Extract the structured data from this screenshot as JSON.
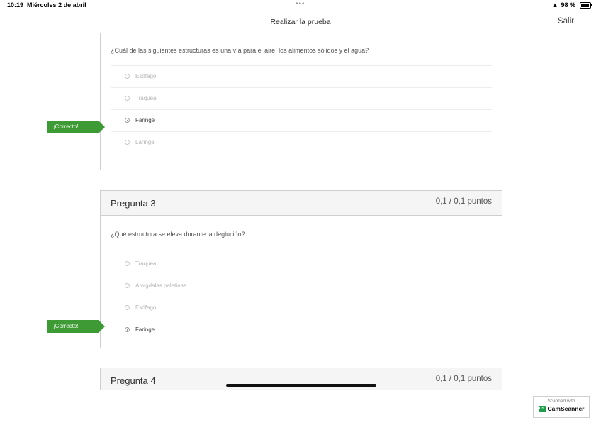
{
  "status_bar": {
    "time": "10:19",
    "date": "Miércoles 2 de abril",
    "dots": "•••",
    "battery_pct": "98 %"
  },
  "navbar": {
    "title": "Realizar la prueba",
    "exit_label": "Salir"
  },
  "correct_flag_label": "¡Correcto!",
  "questions": [
    {
      "text": "¿Cuál de las siguientes estructuras es una vía para el aire, los alimentos sólidos y el agua?",
      "options": [
        "Esófago",
        "Tráquea",
        "Faringe",
        "Laringe"
      ],
      "selected": "Faringe",
      "result": "correct"
    },
    {
      "title": "Pregunta 3",
      "points": "0,1 / 0,1 puntos",
      "text": "¿Qué estructura se eleva durante la deglución?",
      "options": [
        "Tráquea",
        "Amígdalas palatinas",
        "Esófago",
        "Faringe"
      ],
      "selected": "Faringe",
      "result": "correct"
    },
    {
      "title": "Pregunta 4",
      "points": "0,1 / 0,1 puntos"
    }
  ],
  "watermark": {
    "line1": "Scanned with",
    "brand": "CamScanner",
    "logo_text": "CS"
  },
  "colors": {
    "correct_flag": "#3e9a35",
    "card_border": "#cfcfcf",
    "card_header_bg": "#f5f5f5"
  }
}
